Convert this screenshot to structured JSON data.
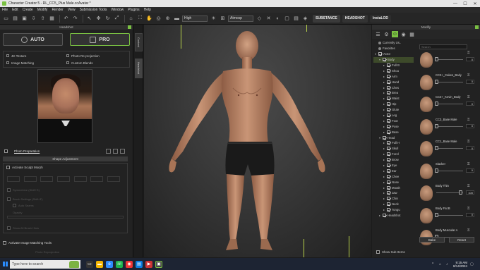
{
  "window": {
    "title": "Character Creator 5 - RL_CC5_Plus Male.ccAvatar *",
    "minimize": "—",
    "maximize": "☐",
    "close": "✕"
  },
  "menu": [
    "File",
    "Edit",
    "Create",
    "Modify",
    "Render",
    "View",
    "Submission Tools",
    "Window",
    "Plugins",
    "Help"
  ],
  "toolbar": {
    "quality": "High",
    "shading": "Atmosp",
    "pill_substance": "SUBSTANCE",
    "pill_headshot": "HEADSHOT",
    "pill_instaLOD": "InstaLOD"
  },
  "left": {
    "panel_title": "Headshot",
    "auto_label": "AUTO",
    "pro_label": "PRO",
    "options": [
      "4K Texture",
      "Photo Re-projection",
      "Image Matching",
      "Custom Blends"
    ],
    "photo_prep": "Photo Preparation",
    "shape_adjustment": "Shape Adjustment",
    "activate_sculpt": "Activate Sculpt Morph",
    "ghost1": "Symmetrize (Shift+S)",
    "ghost2": "Brush Settings (Shift+F)",
    "ghost3": "Auto Seams",
    "ghost4": "Opacity",
    "ghost5": "Show All Brush Hints",
    "activate_matching": "Activate Image Matching Tools",
    "footer": "Photo Reprojection"
  },
  "sidetabs": {
    "content": "Content",
    "headshot": "Headshot"
  },
  "right": {
    "panel_title": "Modify",
    "tree": [
      {
        "label": "Currently Us..",
        "level": 0,
        "type": "bullet",
        "arrow": ""
      },
      {
        "label": "Favorites",
        "level": 0,
        "type": "bullet",
        "arrow": ""
      },
      {
        "label": "Actor",
        "level": 0,
        "type": "chk",
        "arrow": "▾"
      },
      {
        "label": "Body",
        "level": 1,
        "type": "chk",
        "arrow": "▾",
        "selected": true
      },
      {
        "label": "Full B",
        "level": 2,
        "type": "chk",
        "arrow": "▸"
      },
      {
        "label": "Shou",
        "level": 2,
        "type": "chk",
        "arrow": "▸"
      },
      {
        "label": "Arm",
        "level": 2,
        "type": "chk",
        "arrow": "▸"
      },
      {
        "label": "Hand",
        "level": 2,
        "type": "chk",
        "arrow": "▸"
      },
      {
        "label": "Ches",
        "level": 2,
        "type": "chk",
        "arrow": "▸"
      },
      {
        "label": "Brea",
        "level": 2,
        "type": "chk",
        "arrow": "▸"
      },
      {
        "label": "Waist",
        "level": 2,
        "type": "chk",
        "arrow": "▸"
      },
      {
        "label": "Hip",
        "level": 2,
        "type": "chk",
        "arrow": "▸"
      },
      {
        "label": "Glute",
        "level": 2,
        "type": "chk",
        "arrow": "▸"
      },
      {
        "label": "Leg",
        "level": 2,
        "type": "chk",
        "arrow": "▸"
      },
      {
        "label": "Foot",
        "level": 2,
        "type": "chk",
        "arrow": "▸"
      },
      {
        "label": "Pose",
        "level": 2,
        "type": "chk",
        "arrow": "▸"
      },
      {
        "label": "Base",
        "level": 2,
        "type": "chk",
        "arrow": "▸"
      },
      {
        "label": "Head",
        "level": 1,
        "type": "chk",
        "arrow": "▾"
      },
      {
        "label": "Full H",
        "level": 2,
        "type": "chk",
        "arrow": "▸"
      },
      {
        "label": "Skull",
        "level": 2,
        "type": "chk",
        "arrow": "▸"
      },
      {
        "label": "Forel",
        "level": 2,
        "type": "chk",
        "arrow": "▸"
      },
      {
        "label": "Brow",
        "level": 2,
        "type": "chk",
        "arrow": "▸"
      },
      {
        "label": "Eye",
        "level": 2,
        "type": "chk",
        "arrow": "▸"
      },
      {
        "label": "Ear",
        "level": 2,
        "type": "chk",
        "arrow": "▸"
      },
      {
        "label": "Chee",
        "level": 2,
        "type": "chk",
        "arrow": "▸"
      },
      {
        "label": "Nose",
        "level": 2,
        "type": "chk",
        "arrow": "▸"
      },
      {
        "label": "Mouth",
        "level": 2,
        "type": "chk",
        "arrow": "▸"
      },
      {
        "label": "Jaw",
        "level": 2,
        "type": "chk",
        "arrow": "▸"
      },
      {
        "label": "Chin",
        "level": 2,
        "type": "chk",
        "arrow": "▸"
      },
      {
        "label": "Neck",
        "level": 2,
        "type": "chk",
        "arrow": "▸"
      },
      {
        "label": "Tongu",
        "level": 2,
        "type": "chk",
        "arrow": "▸"
      },
      {
        "label": "Headshot",
        "level": 1,
        "type": "chk",
        "arrow": "▸"
      }
    ],
    "search_placeholder": "Search",
    "morphs": [
      {
        "label": "",
        "value": "0",
        "pos": 0.0
      },
      {
        "label": "CC3+_Cakes_Body",
        "value": "0",
        "pos": 0.0
      },
      {
        "label": "CC3+_Kevin_Body",
        "value": "0",
        "pos": 0.0
      },
      {
        "label": "CC3_Base Male",
        "value": "0",
        "pos": 0.0
      },
      {
        "label": "CC1_Base Male",
        "value": "0",
        "pos": 0.0
      },
      {
        "label": "Slacker",
        "value": "0",
        "pos": 0.0
      },
      {
        "label": "Body Thin",
        "value": "100",
        "pos": 1.0
      },
      {
        "label": "Body Fat B",
        "value": "0",
        "pos": 0.0
      },
      {
        "label": "Body Muscular A",
        "value": "",
        "pos": 0.0
      }
    ],
    "btn_bake": "Bake",
    "btn_reset": "Reset",
    "show_sub": "Show Sub Items"
  },
  "taskbar": {
    "search_placeholder": "Type here to search",
    "time": "9:15 AM",
    "date": "8/14/2024"
  }
}
